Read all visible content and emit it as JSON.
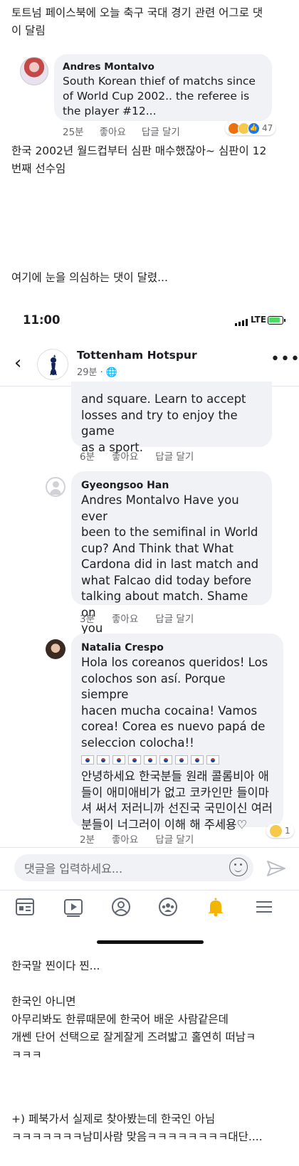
{
  "post": {
    "intro": "토트넘 페이스북에 오늘 축구 국대 경기 관련 어그로 댓\n이 달림",
    "translation": "한국 2002년 월드컵부터 심판 매수했잖아~ 심판이 12\n번째 선수임",
    "doubt": "여기에 눈을 의심하는 댓이 달렸...",
    "outro1": "한국말 찐이다 찐...",
    "outro2": "한국인 아니면\n아무리봐도 한류때문에 한국어 배운 사람같은데\n개쎈 단어 선택으로 잘게잘게 즈려밟고 홀연히 떠남ㅋ\nㅋㅋㅋ",
    "outro3": "+) 페북가서 실제로 찾아봤는데 한국인 아님\nㅋㅋㅋㅋㅋㅋㅋ남미사람 맞음ㅋㅋㅋㅋㅋㅋㅋㅋ대단...."
  },
  "top_comment": {
    "name": "Andres Montalvo",
    "body": "South Korean thief of matchs since of World Cup 2002.. the referee is the player #12...",
    "time": "25분",
    "like": "좋아요",
    "reply": "답글 달기",
    "reaction_count": "47"
  },
  "status_bar": {
    "time": "11:00",
    "network": "LTE"
  },
  "header": {
    "page_name": "Tottenham Hotspur",
    "sub": "29분 · 🌐"
  },
  "comments": [
    {
      "name": "",
      "body": "and square. Learn to accept\nlosses and try to enjoy the game\nas a sport.",
      "time": "6분",
      "like": "좋아요",
      "reply": "답글 달기"
    },
    {
      "name": "Gyeongsoo Han",
      "body": "Andres Montalvo Have you ever\nbeen to the semifinal in World\ncup? And Think that What\nCardona did in last match and\nwhat Falcao did today before\ntalking about match. Shame on\nyou",
      "time": "3분",
      "like": "좋아요",
      "reply": "답글 달기"
    },
    {
      "name": "Natalia Crespo",
      "body": "Hola los coreanos queridos! Los\ncolochos son así. Porque siempre\nhacen mucha cocaina! Vamos\ncorea! Corea es nuevo papá de\nseleccion colocha!!",
      "body_kr": "안녕하세요 한국분들 원래 콜롬비아 애\n들이 애미애비가 없고 코카인만 들이마\n셔 써서 저러니까 선진국 국민이신 여러\n분들이 너그러이 이해 해 주세용♡",
      "time": "2분",
      "like": "좋아요",
      "reply": "답글 달기",
      "reaction_count": "1"
    }
  ],
  "composer": {
    "placeholder": "댓글을 입력하세요..."
  },
  "icons": {
    "nav": [
      "news-feed-icon",
      "watch-icon",
      "profile-icon",
      "groups-icon",
      "notifications-icon",
      "menu-icon"
    ]
  },
  "colors": {
    "accent": "#1877f2",
    "bubble": "#f0f2f5",
    "muted": "#65676b",
    "bell": "#f5b400"
  }
}
